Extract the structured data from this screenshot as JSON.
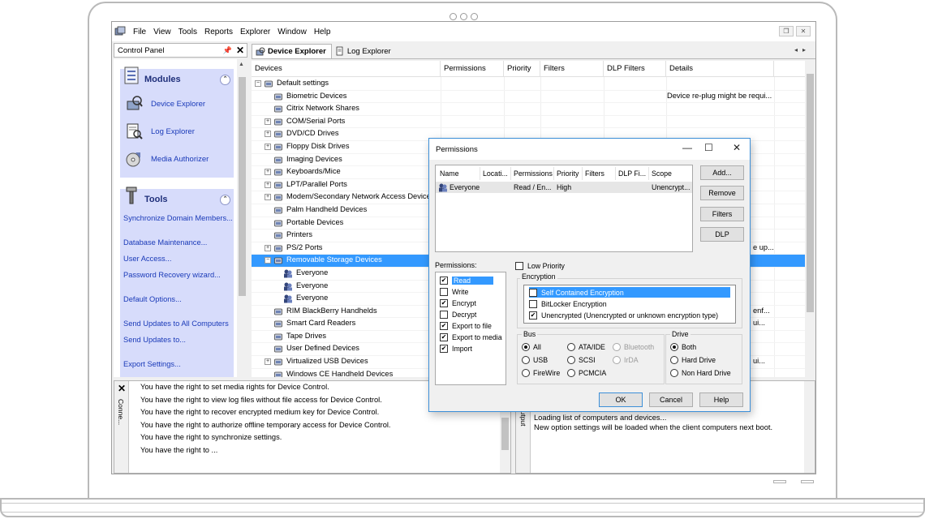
{
  "menubar": {
    "items": [
      "File",
      "View",
      "Tools",
      "Reports",
      "Explorer",
      "Window",
      "Help"
    ]
  },
  "control_panel": {
    "title": "Control Panel",
    "modules": {
      "title": "Modules",
      "items": [
        "Device Explorer",
        "Log Explorer",
        "Media Authorizer"
      ]
    },
    "tools": {
      "title": "Tools",
      "links": [
        "Synchronize Domain Members...",
        "Database Maintenance...",
        "User Access...",
        "Password Recovery wizard...",
        "Default Options...",
        "Send Updates to All Computers",
        "Send Updates to...",
        "Export Settings..."
      ]
    }
  },
  "tabs": [
    "Device Explorer",
    "Log Explorer"
  ],
  "grid": {
    "columns": [
      "Devices",
      "Permissions",
      "Priority",
      "Filters",
      "DLP Filters",
      "Details"
    ],
    "rows": [
      {
        "label": "Default settings",
        "level": 0,
        "expand": "−",
        "detail": ""
      },
      {
        "label": "Biometric Devices",
        "level": 1,
        "expand": "",
        "detail": "Device re-plug might be requi..."
      },
      {
        "label": "Citrix Network Shares",
        "level": 1,
        "expand": "",
        "detail": ""
      },
      {
        "label": "COM/Serial Ports",
        "level": 1,
        "expand": "+",
        "detail": ""
      },
      {
        "label": "DVD/CD Drives",
        "level": 1,
        "expand": "+",
        "detail": ""
      },
      {
        "label": "Floppy Disk Drives",
        "level": 1,
        "expand": "+",
        "detail": ""
      },
      {
        "label": "Imaging Devices",
        "level": 1,
        "expand": "",
        "detail": ""
      },
      {
        "label": "Keyboards/Mice",
        "level": 1,
        "expand": "+",
        "detail": ""
      },
      {
        "label": "LPT/Parallel Ports",
        "level": 1,
        "expand": "+",
        "detail": ""
      },
      {
        "label": "Modem/Secondary Network Access Devices",
        "level": 1,
        "expand": "+",
        "detail": ""
      },
      {
        "label": "Palm Handheld Devices",
        "level": 1,
        "expand": "",
        "detail": ""
      },
      {
        "label": "Portable Devices",
        "level": 1,
        "expand": "",
        "detail": ""
      },
      {
        "label": "Printers",
        "level": 1,
        "expand": "",
        "detail": ""
      },
      {
        "label": "PS/2 Ports",
        "level": 1,
        "expand": "+",
        "detail": "e up..."
      },
      {
        "label": "Removable Storage Devices",
        "level": 1,
        "expand": "−",
        "detail": "",
        "selected": true
      },
      {
        "label": "Everyone",
        "level": 2,
        "expand": "",
        "detail": ""
      },
      {
        "label": "Everyone",
        "level": 2,
        "expand": "",
        "detail": ""
      },
      {
        "label": "Everyone",
        "level": 2,
        "expand": "",
        "detail": ""
      },
      {
        "label": "RIM BlackBerry Handhelds",
        "level": 1,
        "expand": "",
        "detail": "enf..."
      },
      {
        "label": "Smart Card Readers",
        "level": 1,
        "expand": "",
        "detail": "ui..."
      },
      {
        "label": "Tape Drives",
        "level": 1,
        "expand": "",
        "detail": ""
      },
      {
        "label": "User Defined Devices",
        "level": 1,
        "expand": "",
        "detail": ""
      },
      {
        "label": "Virtualized USB Devices",
        "level": 1,
        "expand": "+",
        "detail": "ui..."
      },
      {
        "label": "Windows CE Handheld Devices",
        "level": 1,
        "expand": "",
        "detail": ""
      }
    ]
  },
  "log_panel": {
    "title": "Conne...",
    "lines": [
      "You have the right to set media rights for Device Control.",
      "You have the right to view log files without file access for Device Control.",
      "You have the right to recover encrypted medium key for Device Control.",
      "You have the right to authorize offline temporary access for Device Control.",
      "You have the right to synchronize settings.",
      "You have the right to ..."
    ]
  },
  "output_panel": {
    "title": "Output",
    "lines": [
      "Loading list of computers and devices...",
      "New option settings will be loaded when the client computers next boot."
    ]
  },
  "dialog": {
    "title": "Permissions",
    "list_columns": [
      "Name",
      "Locati...",
      "Permissions",
      "Priority",
      "Filters",
      "DLP Fi...",
      "Scope"
    ],
    "list_row": {
      "name": "Everyone",
      "permissions": "Read / En...",
      "priority": "High",
      "scope": "Unencrypt..."
    },
    "buttons": {
      "add": "Add...",
      "remove": "Remove",
      "filters": "Filters",
      "dlp": "DLP",
      "ok": "OK",
      "cancel": "Cancel",
      "help": "Help"
    },
    "permissions_label": "Permissions:",
    "permissions": [
      {
        "label": "Read",
        "checked": true,
        "selected": true
      },
      {
        "label": "Write",
        "checked": false
      },
      {
        "label": "Encrypt",
        "checked": true
      },
      {
        "label": "Decrypt",
        "checked": false
      },
      {
        "label": "Export to file",
        "checked": true
      },
      {
        "label": "Export to media",
        "checked": true
      },
      {
        "label": "Import",
        "checked": true
      }
    ],
    "low_priority": "Low Priority",
    "encryption": {
      "title": "Encryption",
      "options": [
        {
          "label": "Self Contained Encryption",
          "checked": false,
          "selected": true
        },
        {
          "label": "BitLocker Encryption",
          "checked": false
        },
        {
          "label": "Unencrypted (Unencrypted or unknown encryption type)",
          "checked": true
        }
      ]
    },
    "bus": {
      "title": "Bus",
      "options": [
        {
          "label": "All",
          "on": true
        },
        {
          "label": "ATA/IDE",
          "on": false
        },
        {
          "label": "Bluetooth",
          "on": false,
          "disabled": true
        },
        {
          "label": "USB",
          "on": false
        },
        {
          "label": "SCSI",
          "on": false
        },
        {
          "label": "IrDA",
          "on": false,
          "disabled": true
        },
        {
          "label": "FireWire",
          "on": false
        },
        {
          "label": "PCMCIA",
          "on": false
        }
      ]
    },
    "drive": {
      "title": "Drive",
      "options": [
        {
          "label": "Both",
          "on": true
        },
        {
          "label": "Hard Drive",
          "on": false
        },
        {
          "label": "Non Hard Drive",
          "on": false
        }
      ]
    }
  }
}
